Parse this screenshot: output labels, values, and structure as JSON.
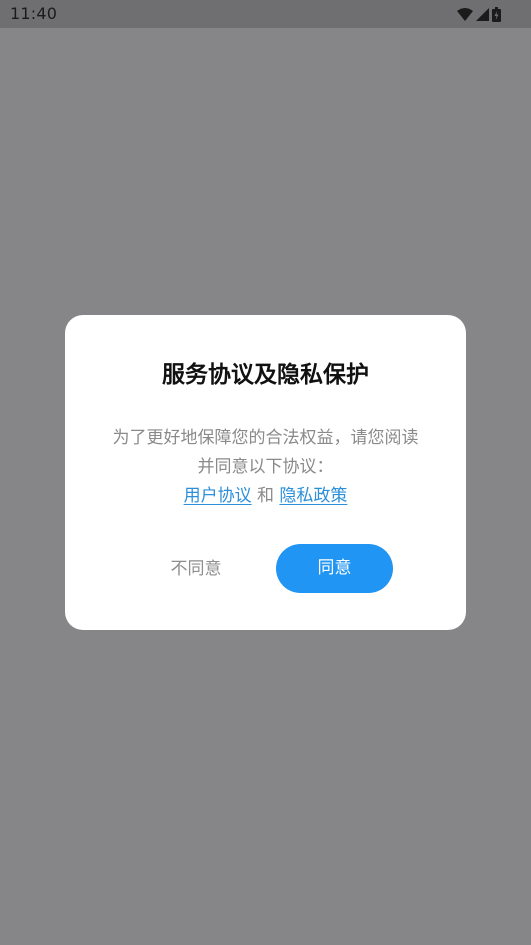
{
  "status_bar": {
    "time": "11:40",
    "icons": [
      "wifi-icon",
      "cellular-signal-icon",
      "battery-icon"
    ]
  },
  "dialog": {
    "title": "服务协议及隐私保护",
    "message_line1": "为了更好地保障您的合法权益，请您阅读",
    "message_line2": "并同意以下协议：",
    "user_agreement_link": "用户协议",
    "conjunction": "和",
    "privacy_policy_link": "隐私政策",
    "disagree_label": "不同意",
    "agree_label": "同意"
  },
  "colors": {
    "backdrop": "#868688",
    "status_bar": "#6f6f71",
    "accent": "#2095f3",
    "link": "#2b8fd9",
    "dialog_background": "#ffffff"
  }
}
